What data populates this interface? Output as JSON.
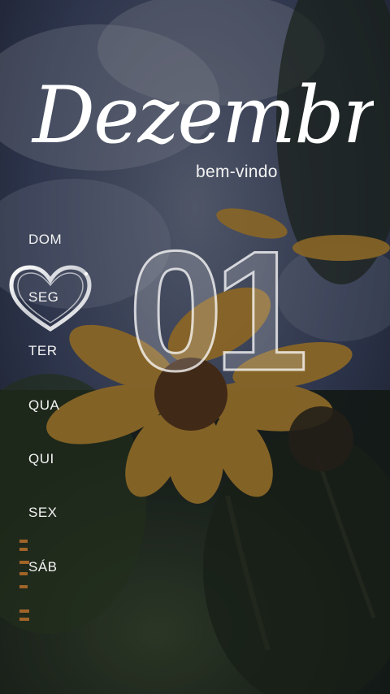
{
  "header": {
    "title": "Dezembro",
    "subtitle": "bem-vindo"
  },
  "calendar": {
    "date_number": "01",
    "selected_day": "SEG",
    "days": [
      "DOM",
      "SEG",
      "TER",
      "QUA",
      "QUI",
      "SEX",
      "SÁB"
    ]
  },
  "colors": {
    "title": "#ffffff",
    "text": "#f2f2f2",
    "petal": "#d19a2e",
    "sky": "#3b4a7a"
  },
  "icons": {
    "selected_marker": "heart-icon",
    "background": "flower-photo"
  }
}
